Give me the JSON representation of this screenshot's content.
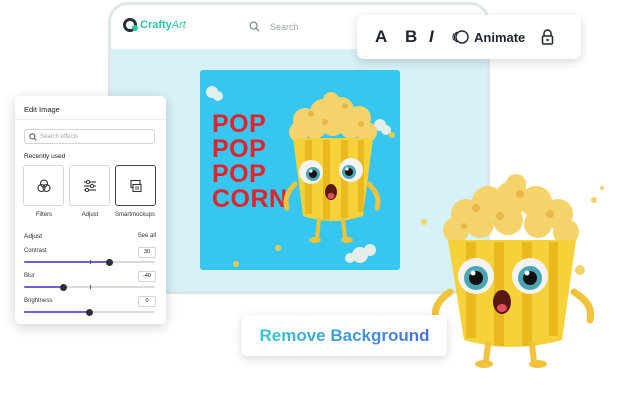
{
  "app": {
    "logo_text": "Crafty",
    "logo_text_italic": "Art"
  },
  "header": {
    "search_placeholder": "Search"
  },
  "poster": {
    "lines": [
      "POP",
      "POP",
      "POP",
      "CORN"
    ]
  },
  "toolbar": {
    "font_label": "A",
    "bold_label": "B",
    "italic_label": "I",
    "animate_label": "Animate"
  },
  "panel": {
    "title": "Edit Image",
    "search_placeholder": "Search effects",
    "recent_label": "Recently used",
    "tiles": [
      {
        "label": "Filters",
        "icon": "filters-icon"
      },
      {
        "label": "Adjust",
        "icon": "adjust-icon"
      },
      {
        "label": "Smartmockups",
        "icon": "mockup-icon"
      }
    ],
    "adjust_label": "Adjust",
    "see_all": "See all",
    "sliders": [
      {
        "label": "Contrast",
        "value": "30",
        "fraction": 0.65
      },
      {
        "label": "Blur",
        "value": "-40",
        "fraction": 0.3
      },
      {
        "label": "Brightness",
        "value": "0",
        "fraction": 0.5
      }
    ]
  },
  "remove_background": {
    "label": "Remove Background"
  },
  "colors": {
    "accent": "#2ec4a6",
    "poster_bg": "#36c6f0",
    "poster_text": "#e3222b",
    "slider_fill": "#6d5de0"
  }
}
